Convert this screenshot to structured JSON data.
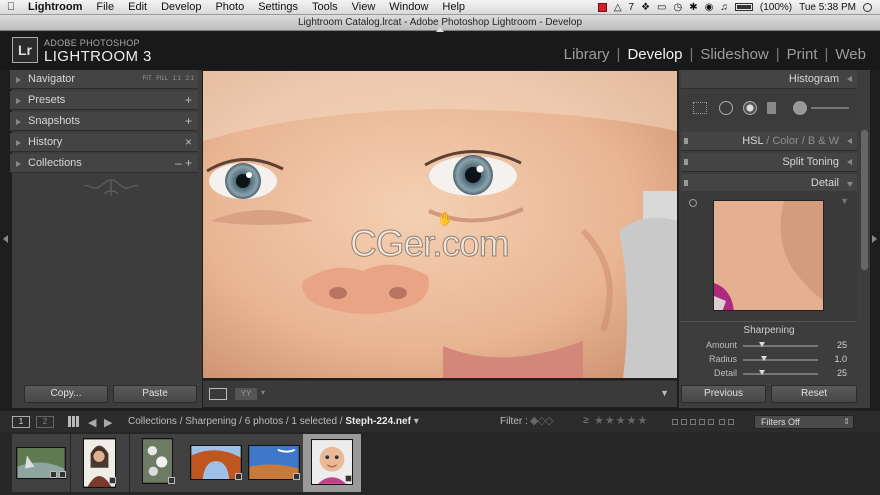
{
  "menubar": {
    "app": "Lightroom",
    "items": [
      "File",
      "Edit",
      "Develop",
      "Photo",
      "Settings",
      "Tools",
      "View",
      "Window",
      "Help"
    ],
    "adobe_count": "7",
    "battery": "(100%)",
    "clock": "Tue 5:38 PM"
  },
  "window": {
    "title": "Lightroom Catalog.lrcat - Adobe Photoshop Lightroom - Develop"
  },
  "identity": {
    "logo": "Lr",
    "brand_top": "ADOBE PHOTOSHOP",
    "brand_main": "LIGHTROOM 3",
    "modules": [
      "Library",
      "Develop",
      "Slideshow",
      "Print",
      "Web"
    ],
    "active_module": "Develop"
  },
  "left_panel": {
    "navigator": "Navigator",
    "nav_zoom": "FIT FILL 1:1 2:1",
    "sections": [
      {
        "label": "Presets",
        "action": "+"
      },
      {
        "label": "Snapshots",
        "action": "+"
      },
      {
        "label": "History",
        "action": "×"
      },
      {
        "label": "Collections",
        "action": "– +"
      }
    ],
    "copy_button": "Copy...",
    "paste_button": "Paste"
  },
  "photo": {
    "watermark": "CGer.com"
  },
  "right_panel": {
    "histogram": "Histogram",
    "hsl_tabs": [
      "HSL",
      "Color",
      "B & W"
    ],
    "split_toning": "Split Toning",
    "detail": "Detail",
    "sharpening": {
      "title": "Sharpening",
      "sliders": [
        {
          "label": "Amount",
          "value": "25",
          "fraction": 0.25
        },
        {
          "label": "Radius",
          "value": "1.0",
          "fraction": 0.28
        },
        {
          "label": "Detail",
          "value": "25",
          "fraction": 0.25
        }
      ]
    },
    "previous_button": "Previous",
    "reset_button": "Reset"
  },
  "filmstrip_bar": {
    "monitor1": "1",
    "monitor2": "2",
    "breadcrumb": "Collections / Sharpening / 6 photos / 1 selected / ",
    "current_file": "Steph-224.nef",
    "filter_label": "Filter :",
    "ge_symbol": "≥",
    "stars": "★★★★★",
    "filters_off": "Filters Off"
  },
  "filmstrip": {
    "count": 6,
    "selected_index": 5
  },
  "colors": {
    "accent": "#f2f2f2",
    "panel": "#3d3d3d",
    "background": "#1e1e1e"
  }
}
